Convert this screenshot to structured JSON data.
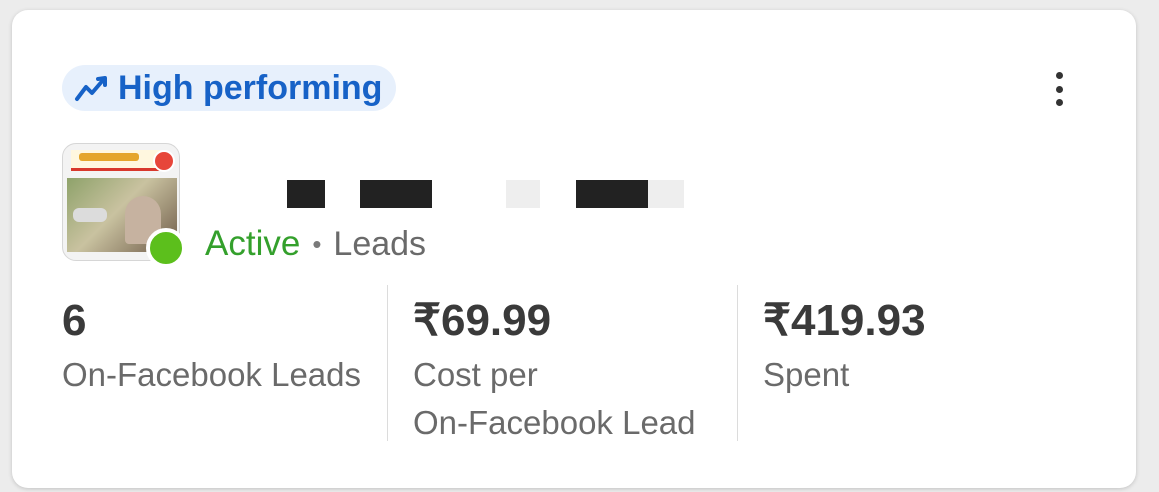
{
  "badge": {
    "icon": "trending-up-icon",
    "label": "High performing",
    "color": "#1762c7",
    "bg": "#e7f0fc"
  },
  "menu": {
    "icon": "more-vertical-icon"
  },
  "ad": {
    "thumbnail": "ad-thumbnail",
    "status": "Active",
    "status_color": "#34a02c",
    "separator": "•",
    "objective": "Leads"
  },
  "metrics": [
    {
      "value": "6",
      "label": "On-Facebook Leads"
    },
    {
      "value": "₹69.99",
      "label": "Cost per\nOn-Facebook Lead"
    },
    {
      "value": "₹419.93",
      "label": "Spent"
    }
  ]
}
